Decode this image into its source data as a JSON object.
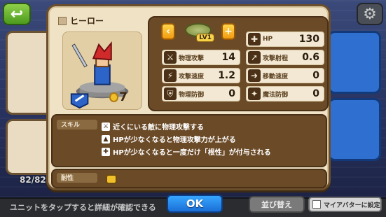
{
  "top": {
    "back_icon": "back-arrow-icon",
    "settings_icon": "gear-icon"
  },
  "background": {
    "unit_count": "82/82"
  },
  "modal": {
    "title": "ヒーロー",
    "level_badge": "LV1",
    "rank": "7",
    "stats": [
      {
        "icon": "sword-icon",
        "label": "物理攻撃",
        "value": "14"
      },
      {
        "icon": "hp-cross-icon",
        "label": "HP",
        "value": "130"
      },
      {
        "icon": "range-icon",
        "label": "攻撃射程",
        "value": "0.6"
      },
      {
        "icon": "speed-icon",
        "label": "攻撃速度",
        "value": "1.2"
      },
      {
        "icon": "move-icon",
        "label": "移動速度",
        "value": "0"
      },
      {
        "icon": "defense-icon",
        "label": "物理防御",
        "value": "0"
      },
      {
        "icon": "magic-defense-icon",
        "label": "魔法防御",
        "value": "0"
      }
    ],
    "skills_label": "スキル",
    "skills": [
      "近くにいる敵に物理攻撃する",
      "HPが少なくなると物理攻撃力が上がる",
      "HPが少なくなると一度だけ「根性」が付与される"
    ],
    "trait_label": "耐性"
  },
  "footer": {
    "hint": "ユニットをタップすると詳細が確認できる",
    "ok_label": "OK",
    "sort_label": "並び替え",
    "myavatar_label": "マイアバターに設定"
  }
}
